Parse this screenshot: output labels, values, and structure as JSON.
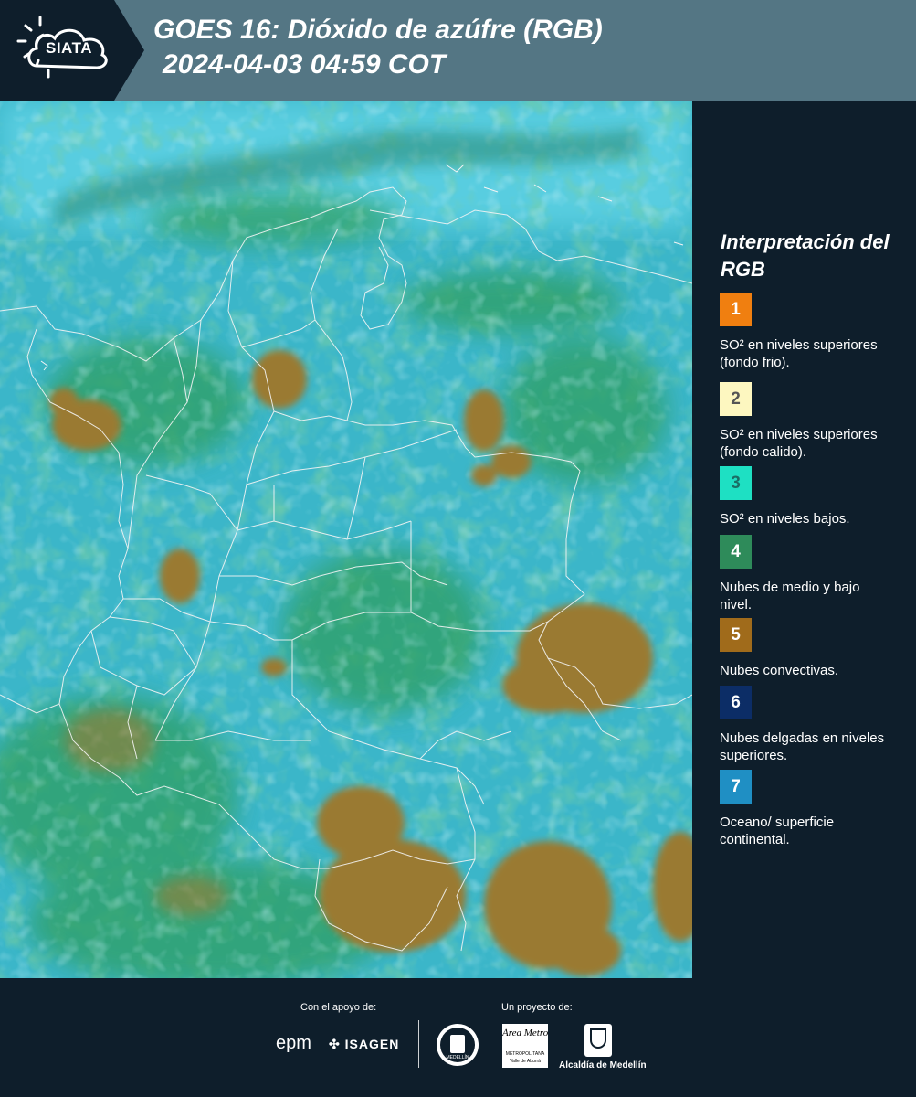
{
  "header": {
    "logo_text": "SIATA",
    "title_line1": "GOES 16: Dióxido de azúfre (RGB)",
    "title_line2": "2024-04-03 04:59 COT",
    "background_color": "#547684"
  },
  "map": {
    "product": "GOES 16 SO2 RGB composite",
    "region": "Colombia",
    "dominant_colors": [
      "#3bb6c9",
      "#2f9f63",
      "#9a7a30"
    ]
  },
  "legend": {
    "title": "Interpretación del RGB",
    "items": [
      {
        "number": "1",
        "label": "SO² en niveles superiores (fondo frio).",
        "color": "#f07f10",
        "text_color": "#ffffff"
      },
      {
        "number": "2",
        "label": "SO² en niveles superiores (fondo calido).",
        "color": "#fdf7c0",
        "text_color": "#555555"
      },
      {
        "number": "3",
        "label": "SO² en niveles bajos.",
        "color": "#1ee0c3",
        "text_color": "#1a6f65"
      },
      {
        "number": "4",
        "label": "Nubes de medio y bajo nivel.",
        "color": "#2e8b5a",
        "text_color": "#ffffff"
      },
      {
        "number": "5",
        "label": "Nubes convectivas.",
        "color": "#a06b1b",
        "text_color": "#ffffff"
      },
      {
        "number": "6",
        "label": "Nubes delgadas en niveles superiores.",
        "color": "#0c2d66",
        "text_color": "#ffffff"
      },
      {
        "number": "7",
        "label": "Oceano/ superficie continental.",
        "color": "#1f8fc4",
        "text_color": "#ffffff"
      }
    ]
  },
  "footer": {
    "support_label": "Con el apoyo de:",
    "project_label": "Un proyecto de:",
    "sponsors": [
      "epm",
      "ISAGEN"
    ],
    "partners": [
      "Área Metropolitana",
      "Alcaldía de Medellín"
    ],
    "area_sub1": "METROPOLITANA",
    "area_sub2": "Valle de Aburrá",
    "seal_text": "MEDELLÍN",
    "alcaldia_label": "Alcaldía de Medellín"
  }
}
